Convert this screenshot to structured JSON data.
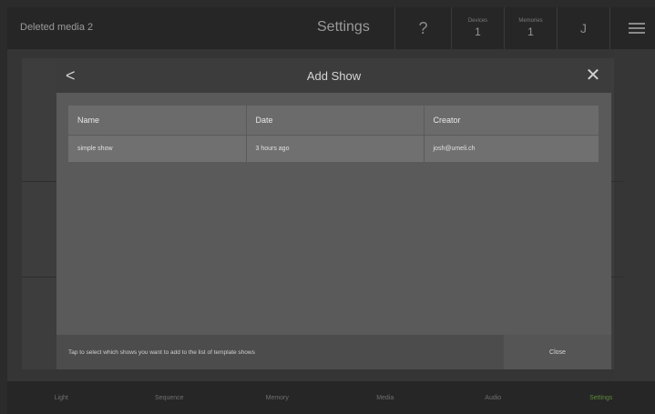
{
  "topbar": {
    "left_title": "Deleted media 2",
    "center_title": "Settings",
    "help_icon": "?",
    "devices": {
      "label": "Devices",
      "count": "1"
    },
    "memories": {
      "label": "Memories",
      "count": "1"
    },
    "user_initial": "J"
  },
  "modal": {
    "title": "Add Show",
    "back_icon": "<",
    "close_icon": "✕",
    "table": {
      "headers": [
        "Name",
        "Date",
        "Creator"
      ],
      "rows": [
        [
          "simple show",
          "3 hours ago",
          "josh@umeli.ch"
        ]
      ]
    },
    "footer_text": "Tap to select which shows you want to add to the list of template shows",
    "close_label": "Close"
  },
  "tabs": [
    {
      "label": "Light"
    },
    {
      "label": "Sequence"
    },
    {
      "label": "Memory"
    },
    {
      "label": "Media"
    },
    {
      "label": "Audio"
    },
    {
      "label": "Settings",
      "active": true
    }
  ],
  "colors": {
    "active_tab": "#5d8a3a",
    "modal_bg": "#5a5a5a",
    "header_bg": "#3c3c3c"
  }
}
